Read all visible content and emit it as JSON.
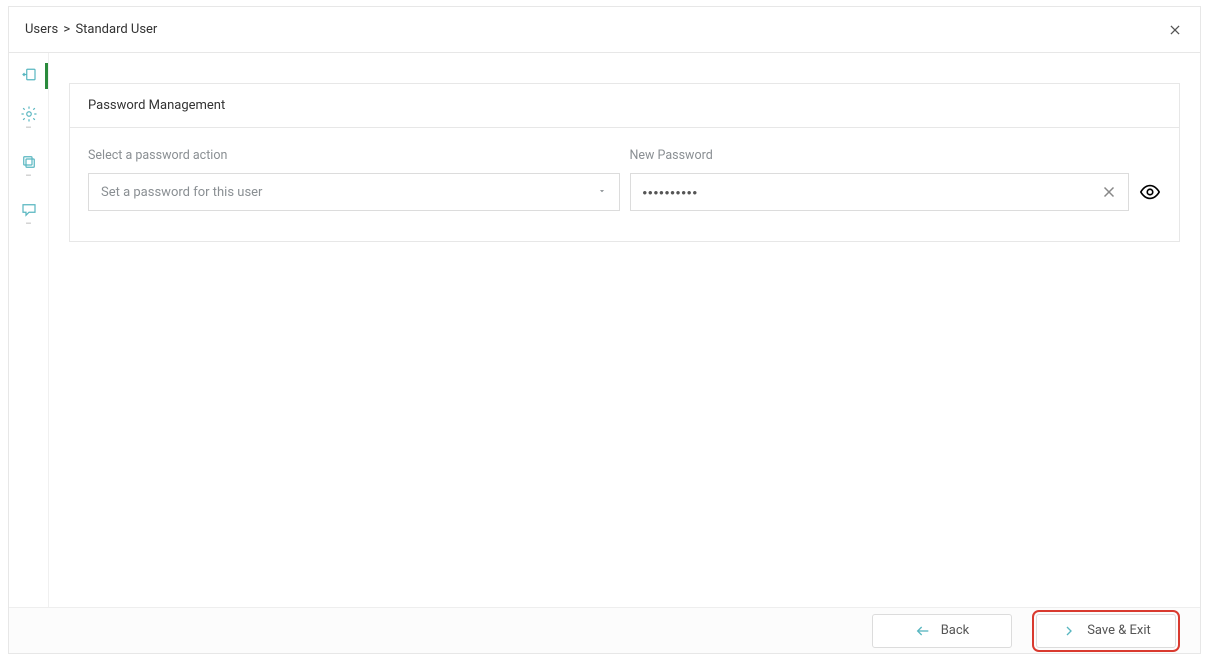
{
  "header": {
    "breadcrumb_root": "Users",
    "breadcrumb_current": "Standard User"
  },
  "sidebar": {
    "items": [
      {
        "name": "user-entry-icon",
        "active": true
      },
      {
        "name": "gear-icon",
        "active": false
      },
      {
        "name": "copy-icon",
        "active": false
      },
      {
        "name": "chat-icon",
        "active": false
      }
    ]
  },
  "panel": {
    "title": "Password Management",
    "action_label": "Select a password action",
    "action_value": "Set a password for this user",
    "newpw_label": "New Password",
    "newpw_value": "••••••••••"
  },
  "footer": {
    "back_label": "Back",
    "save_label": "Save & Exit"
  }
}
